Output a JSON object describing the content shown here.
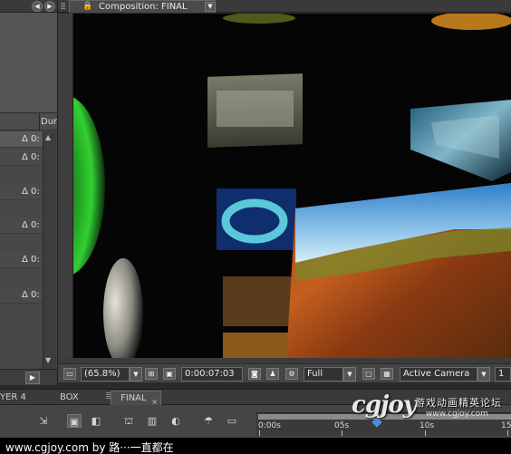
{
  "project_panel": {
    "column_header": "Duration",
    "rows": [
      "Δ 0:",
      "Δ 0:",
      "Δ 0:",
      "Δ 0:",
      "Δ 0:",
      "Δ 0:"
    ]
  },
  "composition": {
    "tab_label": "Composition: FINAL"
  },
  "viewer_toolbar": {
    "zoom": "(65.8%)",
    "timecode": "0:00:07:03",
    "resolution": "Full",
    "view": "Active Camera",
    "views_count": "1"
  },
  "timeline": {
    "tabs": [
      "YER 4",
      "BOX",
      "FINAL"
    ],
    "close_glyph": "×",
    "ruler_labels": [
      "0:00s",
      "05s",
      "10s",
      "15"
    ]
  },
  "watermark": {
    "logo": "cgjoy",
    "chinese": "游戏动画精英论坛",
    "url": "www.cgjoy.com"
  },
  "caption": {
    "text": "www.cgjoy.com by 路···一直都在"
  },
  "icons": {
    "lock": "lock-icon",
    "menu": "menu-icon",
    "play": "play-icon",
    "camera": "snapshot-icon",
    "channels": "rgb-channels-icon",
    "grid": "grid-icon",
    "transparency": "transparency-grid-icon"
  }
}
